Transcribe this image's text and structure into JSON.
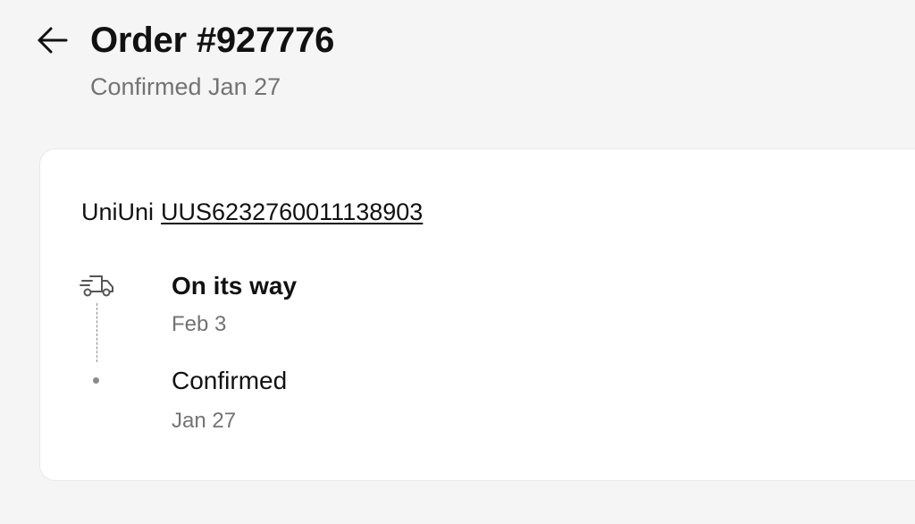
{
  "header": {
    "title": "Order #927776",
    "subtitle": "Confirmed Jan 27",
    "back_icon": "arrow-left-icon"
  },
  "shipment": {
    "carrier": "UniUni",
    "tracking_number": "UUS6232760011138903"
  },
  "timeline": {
    "steps": [
      {
        "title": "On its way",
        "date": "Feb 3",
        "icon": "truck-icon",
        "current": true
      },
      {
        "title": "Confirmed",
        "date": "Jan 27",
        "icon": "dot-icon",
        "current": false
      }
    ]
  },
  "colors": {
    "background": "#f5f5f5",
    "card": "#ffffff",
    "text": "#111111",
    "muted": "#737373",
    "timeline": "#8a8a8a"
  }
}
